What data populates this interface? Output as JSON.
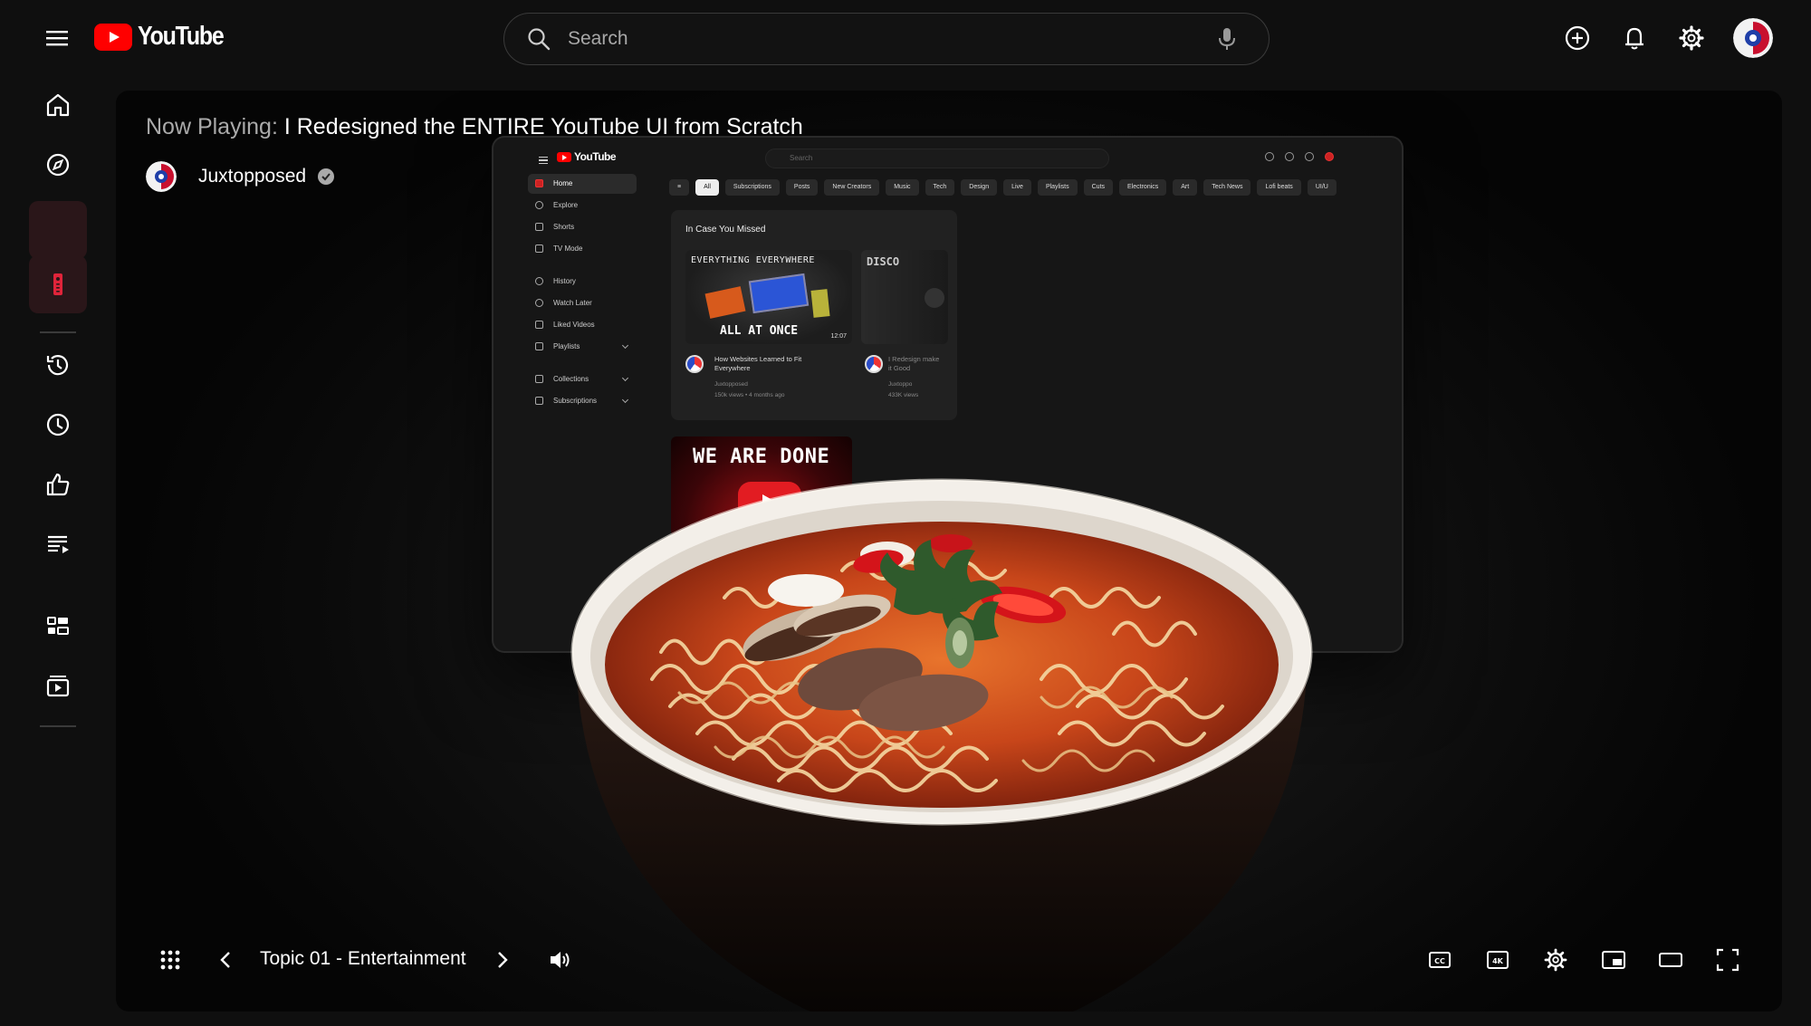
{
  "header": {
    "logo_text": "YouTube",
    "search_placeholder": "Search"
  },
  "icons": {
    "header": [
      "menu-icon",
      "youtube-logo-icon",
      "search-icon",
      "mic-icon",
      "create-plus-icon",
      "bell-icon",
      "gear-icon",
      "avatar"
    ],
    "sidebar": [
      "home-icon",
      "explore-icon",
      "shorts-icon",
      "tv-remote-icon",
      "history-icon",
      "watch-later-icon",
      "thumbs-up-icon",
      "playlist-icon",
      "collections-icon",
      "subscriptions-icon"
    ],
    "controls": [
      "grid-menu-icon",
      "chevron-left-icon",
      "chevron-right-icon",
      "volume-icon",
      "captions-icon",
      "4k-icon",
      "gear-icon",
      "miniplayer-icon",
      "theater-mode-icon",
      "fullscreen-icon"
    ]
  },
  "colors": {
    "brand_red": "#ff0000",
    "active_nav_bg": "#2a1619",
    "active_nav_icon": "#e0243a",
    "background": "#0f0f0f"
  },
  "now_playing": {
    "label": "Now Playing:",
    "title": "I Redesigned the ENTIRE YouTube UI from Scratch",
    "channel": "Juxtopposed"
  },
  "video_frame": {
    "logo_text": "YouTube",
    "search_placeholder": "Search",
    "sidebar": {
      "items": [
        "Home",
        "Explore",
        "Shorts",
        "TV Mode",
        "History",
        "Watch Later",
        "Liked Videos",
        "Playlists",
        "Collections",
        "Subscriptions"
      ]
    },
    "chips": [
      "All",
      "Subscriptions",
      "Posts",
      "New Creators",
      "Music",
      "Tech",
      "Design",
      "Live",
      "Playlists",
      "Cuts",
      "Electronics",
      "Art",
      "Tech News",
      "Lofi beats",
      "UI/U"
    ],
    "section_title": "In Case You Missed",
    "thumb1_top": "EVERYTHING EVERYWHERE",
    "thumb1_bottom": "ALL AT ONCE",
    "thumb1_duration": "12:07",
    "thumb2_text": "DISCO",
    "video1_title": "How Websites Learned to Fit Everywhere",
    "video1_channel": "Juxtopposed",
    "video1_meta": "150k views • 4 months ago",
    "video2_title": "I Redesign make it Good",
    "video2_channel": "Juxtoppo",
    "video2_meta": "433K views",
    "big_thumb_text": "WE ARE DONE"
  },
  "controls": {
    "topic": "Topic 01 - Entertainment"
  }
}
